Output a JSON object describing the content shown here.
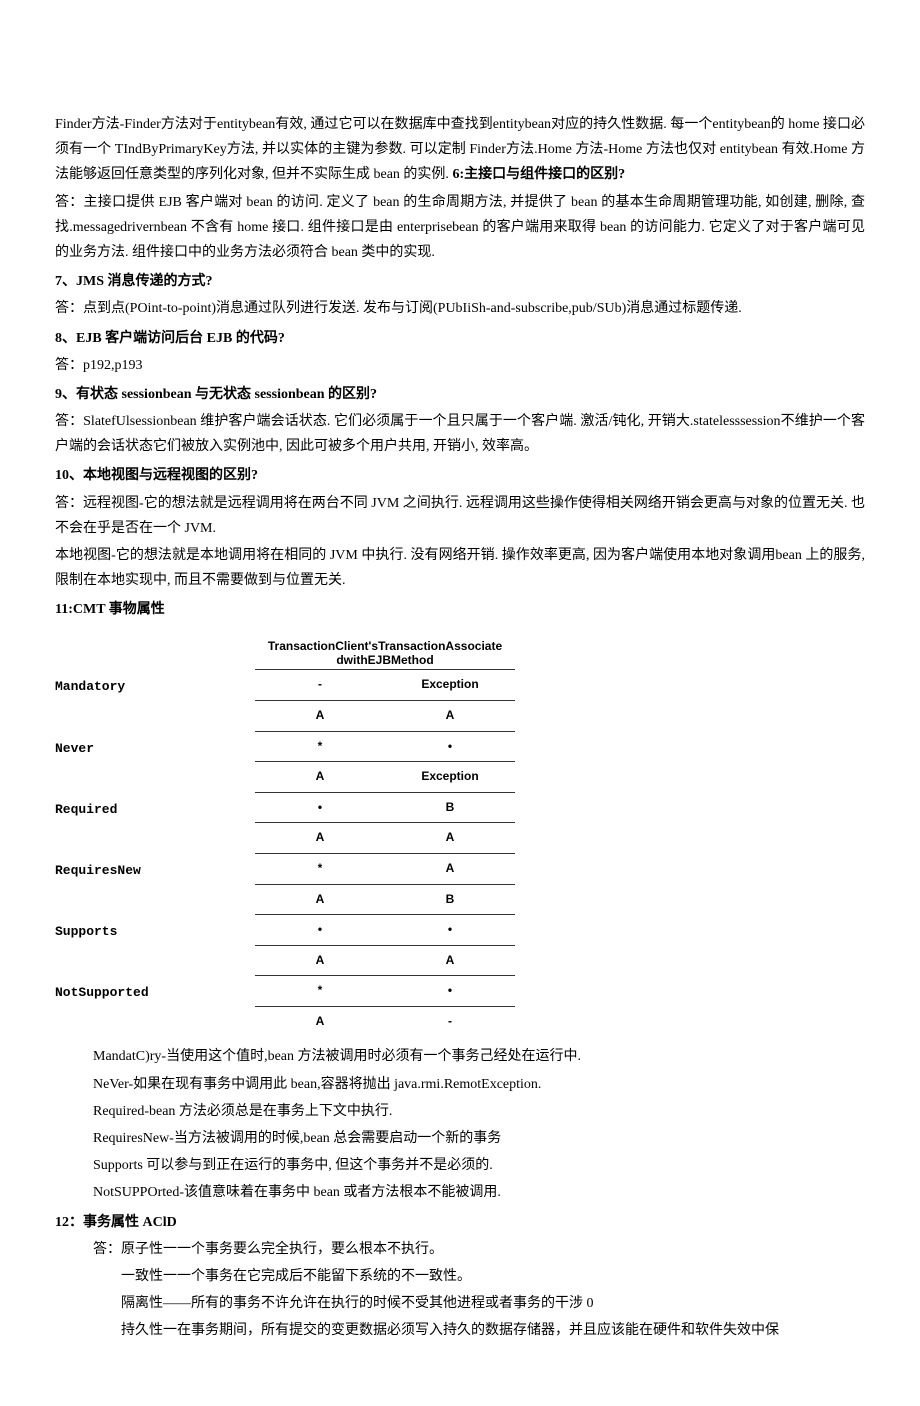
{
  "intro_para": "Finder方法-Finder方法对于entitybean有效, 通过它可以在数据库中查找到entitybean对应的持久性数据. 每一个entitybean的 home 接口必须有一个 TIndByPrimaryKey方法, 并以实体的主键为参数. 可以定制 Finder方法.Home 方法-Home 方法也仅对 entitybean 有效.Home 方法能够返回任意类型的序列化对象, 但并不实际生成 bean 的实例. ",
  "intro_bold": "6:主接口与组件接口的区别?",
  "a6": "答：主接口提供 EJB 客户端对 bean 的访问. 定义了 bean 的生命周期方法, 并提供了 bean 的基本生命周期管理功能, 如创建, 删除, 查找.messagedrivernbean 不含有 home 接口. 组件接口是由 enterprisebean 的客户端用来取得 bean 的访问能力. 它定义了对于客户端可见的业务方法. 组件接口中的业务方法必须符合 bean 类中的实现.",
  "q7": "7、JMS 消息传递的方式?",
  "a7": "答：点到点(POint-to-point)消息通过队列进行发送. 发布与订阅(PUbIiSh-and-subscribe,pub/SUb)消息通过标题传递.",
  "q8": "8、EJB 客户端访问后台 EJB 的代码?",
  "a8": "答：p192,p193",
  "q9": "9、有状态 sessionbean 与无状态 sessionbean 的区别?",
  "a9": "答：SlatefUlsessionbean 维护客户端会话状态. 它们必须属于一个且只属于一个客户端. 激活/钝化, 开销大.statelesssession不维护一个客户端的会话状态它们被放入实例池中, 因此可被多个用户共用, 开销小, 效率高。",
  "q10": "10、本地视图与远程视图的区别?",
  "a10a": "答：远程视图-它的想法就是远程调用将在两台不同 JVM 之间执行. 远程调用这些操作使得相关网络开销会更高与对象的位置无关. 也不会在乎是否在一个 JVM.",
  "a10b": "本地视图-它的想法就是本地调用将在相同的 JVM 中执行. 没有网络开销. 操作效率更高, 因为客户端使用本地对象调用bean 上的服务, 限制在本地实现中, 而且不需要做到与位置无关.",
  "q11": "11:CMT 事物属性",
  "chart_data": {
    "type": "table",
    "header_left": "TransactionClient'sTransaction",
    "header_right": "AssociatedwithEJBMethod",
    "rows": [
      {
        "label": "Mandatory",
        "cells": [
          [
            "-",
            "Exception"
          ],
          [
            "A",
            "A"
          ]
        ]
      },
      {
        "label": "Never",
        "cells": [
          [
            "*",
            "•"
          ],
          [
            "A",
            "Exception"
          ]
        ]
      },
      {
        "label": "Required",
        "cells": [
          [
            "•",
            "B"
          ],
          [
            "A",
            "A"
          ]
        ]
      },
      {
        "label": "RequiresNew",
        "cells": [
          [
            "*",
            "A"
          ],
          [
            "A",
            "B"
          ]
        ]
      },
      {
        "label": "Supports",
        "cells": [
          [
            "•",
            "•"
          ],
          [
            "A",
            "A"
          ]
        ]
      },
      {
        "label": "NotSupported",
        "cells": [
          [
            "*",
            "•"
          ],
          [
            "A",
            "-"
          ]
        ]
      }
    ]
  },
  "desc11": [
    "MandatC)ry-当使用这个值时,bean 方法被调用时必须有一个事务己经处在运行中.",
    "NeVer-如果在现有事务中调用此 bean,容器将抛出 java.rmi.RemotException.",
    "Required-bean 方法必须总是在事务上下文中执行.",
    "RequiresNew-当方法被调用的时候,bean 总会需要启动一个新的事务",
    "Supports 可以参与到正在运行的事务中, 但这个事务并不是必须的.",
    "NotSUPPOrted-该值意味着在事务中 bean 或者方法根本不能被调用."
  ],
  "q12": "12：事务属性 AClD",
  "a12_lead": "答：原子性一一个事务要么完全执行，要么根本不执行。",
  "a12_lines": [
    "一致性一一个事务在它完成后不能留下系统的不一致性。",
    "隔离性——所有的事务不许允许在执行的时候不受其他进程或者事务的干涉 0",
    "持久性一在事务期间，所有提交的变更数据必须写入持久的数据存储器，并且应该能在硬件和软件失效中保"
  ]
}
